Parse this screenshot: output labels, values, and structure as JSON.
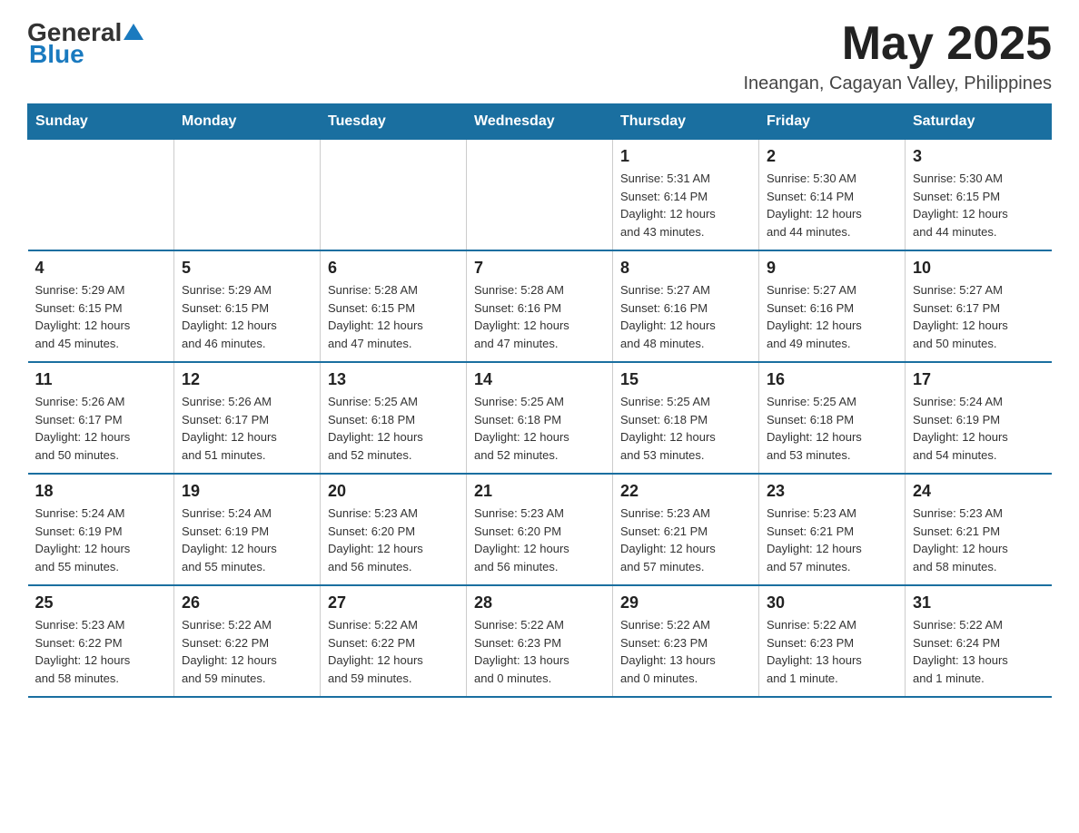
{
  "logo": {
    "text_general": "General",
    "text_blue": "Blue"
  },
  "header": {
    "month_year": "May 2025",
    "location": "Ineangan, Cagayan Valley, Philippines"
  },
  "days_of_week": [
    "Sunday",
    "Monday",
    "Tuesday",
    "Wednesday",
    "Thursday",
    "Friday",
    "Saturday"
  ],
  "weeks": [
    [
      {
        "day": "",
        "info": ""
      },
      {
        "day": "",
        "info": ""
      },
      {
        "day": "",
        "info": ""
      },
      {
        "day": "",
        "info": ""
      },
      {
        "day": "1",
        "info": "Sunrise: 5:31 AM\nSunset: 6:14 PM\nDaylight: 12 hours\nand 43 minutes."
      },
      {
        "day": "2",
        "info": "Sunrise: 5:30 AM\nSunset: 6:14 PM\nDaylight: 12 hours\nand 44 minutes."
      },
      {
        "day": "3",
        "info": "Sunrise: 5:30 AM\nSunset: 6:15 PM\nDaylight: 12 hours\nand 44 minutes."
      }
    ],
    [
      {
        "day": "4",
        "info": "Sunrise: 5:29 AM\nSunset: 6:15 PM\nDaylight: 12 hours\nand 45 minutes."
      },
      {
        "day": "5",
        "info": "Sunrise: 5:29 AM\nSunset: 6:15 PM\nDaylight: 12 hours\nand 46 minutes."
      },
      {
        "day": "6",
        "info": "Sunrise: 5:28 AM\nSunset: 6:15 PM\nDaylight: 12 hours\nand 47 minutes."
      },
      {
        "day": "7",
        "info": "Sunrise: 5:28 AM\nSunset: 6:16 PM\nDaylight: 12 hours\nand 47 minutes."
      },
      {
        "day": "8",
        "info": "Sunrise: 5:27 AM\nSunset: 6:16 PM\nDaylight: 12 hours\nand 48 minutes."
      },
      {
        "day": "9",
        "info": "Sunrise: 5:27 AM\nSunset: 6:16 PM\nDaylight: 12 hours\nand 49 minutes."
      },
      {
        "day": "10",
        "info": "Sunrise: 5:27 AM\nSunset: 6:17 PM\nDaylight: 12 hours\nand 50 minutes."
      }
    ],
    [
      {
        "day": "11",
        "info": "Sunrise: 5:26 AM\nSunset: 6:17 PM\nDaylight: 12 hours\nand 50 minutes."
      },
      {
        "day": "12",
        "info": "Sunrise: 5:26 AM\nSunset: 6:17 PM\nDaylight: 12 hours\nand 51 minutes."
      },
      {
        "day": "13",
        "info": "Sunrise: 5:25 AM\nSunset: 6:18 PM\nDaylight: 12 hours\nand 52 minutes."
      },
      {
        "day": "14",
        "info": "Sunrise: 5:25 AM\nSunset: 6:18 PM\nDaylight: 12 hours\nand 52 minutes."
      },
      {
        "day": "15",
        "info": "Sunrise: 5:25 AM\nSunset: 6:18 PM\nDaylight: 12 hours\nand 53 minutes."
      },
      {
        "day": "16",
        "info": "Sunrise: 5:25 AM\nSunset: 6:18 PM\nDaylight: 12 hours\nand 53 minutes."
      },
      {
        "day": "17",
        "info": "Sunrise: 5:24 AM\nSunset: 6:19 PM\nDaylight: 12 hours\nand 54 minutes."
      }
    ],
    [
      {
        "day": "18",
        "info": "Sunrise: 5:24 AM\nSunset: 6:19 PM\nDaylight: 12 hours\nand 55 minutes."
      },
      {
        "day": "19",
        "info": "Sunrise: 5:24 AM\nSunset: 6:19 PM\nDaylight: 12 hours\nand 55 minutes."
      },
      {
        "day": "20",
        "info": "Sunrise: 5:23 AM\nSunset: 6:20 PM\nDaylight: 12 hours\nand 56 minutes."
      },
      {
        "day": "21",
        "info": "Sunrise: 5:23 AM\nSunset: 6:20 PM\nDaylight: 12 hours\nand 56 minutes."
      },
      {
        "day": "22",
        "info": "Sunrise: 5:23 AM\nSunset: 6:21 PM\nDaylight: 12 hours\nand 57 minutes."
      },
      {
        "day": "23",
        "info": "Sunrise: 5:23 AM\nSunset: 6:21 PM\nDaylight: 12 hours\nand 57 minutes."
      },
      {
        "day": "24",
        "info": "Sunrise: 5:23 AM\nSunset: 6:21 PM\nDaylight: 12 hours\nand 58 minutes."
      }
    ],
    [
      {
        "day": "25",
        "info": "Sunrise: 5:23 AM\nSunset: 6:22 PM\nDaylight: 12 hours\nand 58 minutes."
      },
      {
        "day": "26",
        "info": "Sunrise: 5:22 AM\nSunset: 6:22 PM\nDaylight: 12 hours\nand 59 minutes."
      },
      {
        "day": "27",
        "info": "Sunrise: 5:22 AM\nSunset: 6:22 PM\nDaylight: 12 hours\nand 59 minutes."
      },
      {
        "day": "28",
        "info": "Sunrise: 5:22 AM\nSunset: 6:23 PM\nDaylight: 13 hours\nand 0 minutes."
      },
      {
        "day": "29",
        "info": "Sunrise: 5:22 AM\nSunset: 6:23 PM\nDaylight: 13 hours\nand 0 minutes."
      },
      {
        "day": "30",
        "info": "Sunrise: 5:22 AM\nSunset: 6:23 PM\nDaylight: 13 hours\nand 1 minute."
      },
      {
        "day": "31",
        "info": "Sunrise: 5:22 AM\nSunset: 6:24 PM\nDaylight: 13 hours\nand 1 minute."
      }
    ]
  ]
}
